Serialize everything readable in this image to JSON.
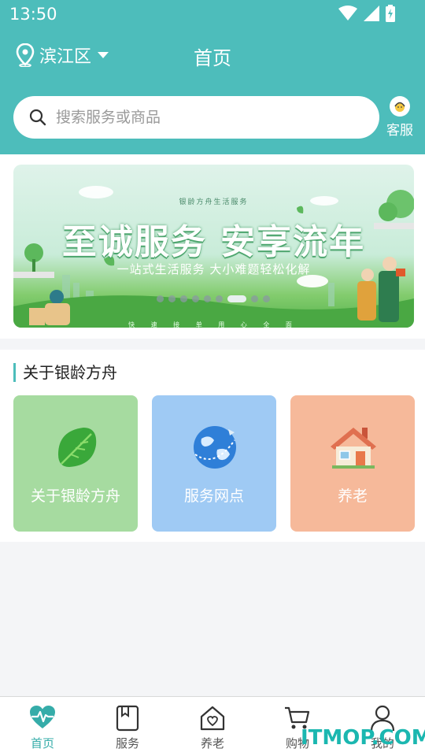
{
  "status": {
    "time": "13:50"
  },
  "header": {
    "location": "滨江区",
    "title": "首页",
    "search_placeholder": "搜索服务或商品",
    "service_label": "客服"
  },
  "banner": {
    "subtitle": "银龄方舟生活服务",
    "title": "至诚服务 安享流年",
    "slogan": "一站式生活服务 大小难题轻松化解",
    "footer": "快 速 接 单 用 心 全 面",
    "dots_total": 9,
    "dots_active": 7
  },
  "about": {
    "title": "关于银龄方舟",
    "cards": [
      {
        "label": "关于银龄方舟",
        "color": "#a6dba0",
        "icon": "leaf-icon"
      },
      {
        "label": "服务网点",
        "color": "#9fcaf4",
        "icon": "globe-icon"
      },
      {
        "label": "养老",
        "color": "#f6b99a",
        "icon": "house-icon"
      }
    ]
  },
  "tabbar": {
    "items": [
      {
        "label": "首页",
        "icon": "heartbeat-icon",
        "active": true
      },
      {
        "label": "服务",
        "icon": "bookmark-icon",
        "active": false
      },
      {
        "label": "养老",
        "icon": "home-heart-icon",
        "active": false
      },
      {
        "label": "购物",
        "icon": "cart-icon",
        "active": false
      },
      {
        "label": "我的",
        "icon": "user-icon",
        "active": false
      }
    ]
  },
  "watermark": "ITMOP.COM",
  "colors": {
    "brand": "#4dbdbb",
    "tab_active": "#35aca9"
  }
}
